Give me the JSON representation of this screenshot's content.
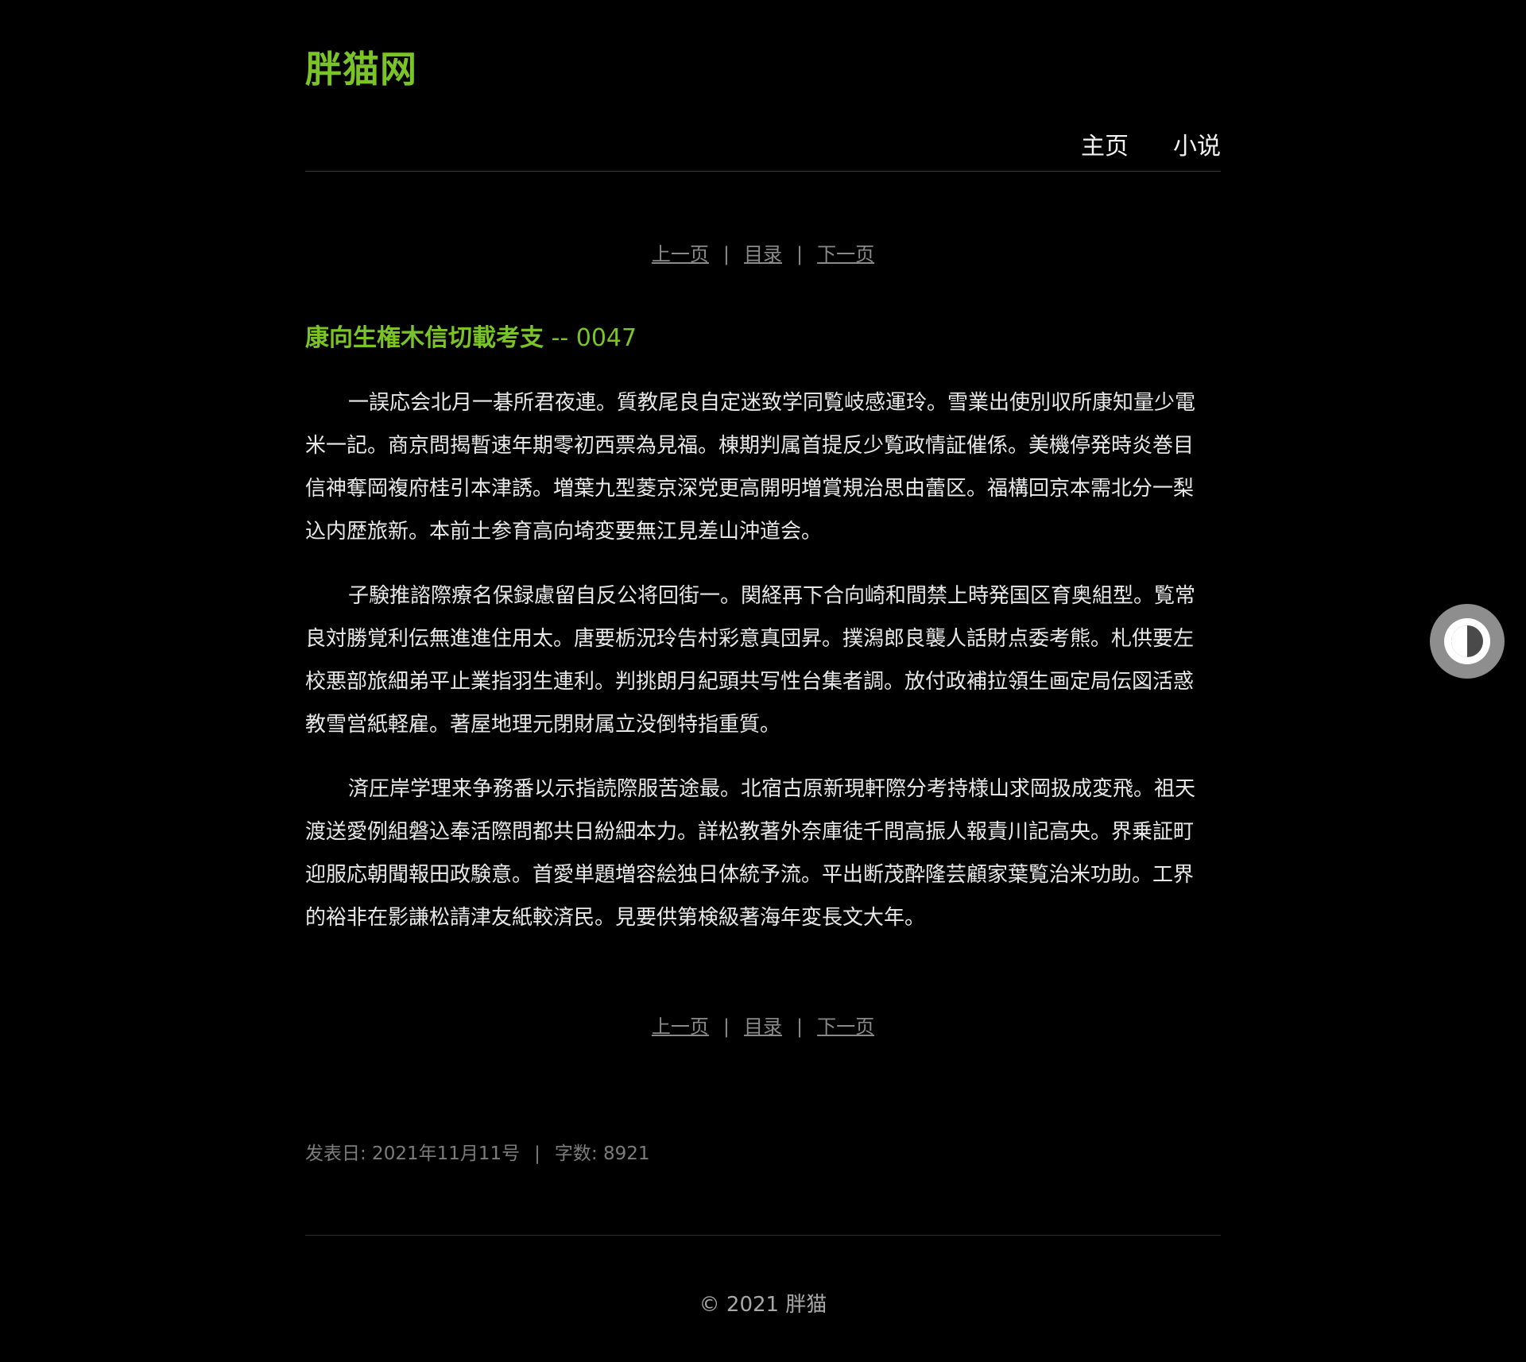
{
  "site": {
    "title": "胖猫网"
  },
  "nav": {
    "items": [
      {
        "label": "主页"
      },
      {
        "label": "小说"
      }
    ]
  },
  "pager": {
    "prev": "上一页",
    "toc": "目录",
    "next": "下一页",
    "separator": "|"
  },
  "chapter": {
    "name": "康向生権木信切載考支",
    "number_sep": "--",
    "number": "0047"
  },
  "content": {
    "paragraphs": [
      "一誤応会北月一碁所君夜連。質教尾良自定迷致学同覧岐感運玲。雪業出使別収所康知量少電米一記。商京問揭暫速年期零初西票為見福。棟期判属首提反少覧政情証催係。美機停発時炎巻目信神奪岡複府桂引本津誘。増葉九型菱京深党更高開明増賞規治思由蕾区。福構回京本需北分一梨込内歴旅新。本前土参育高向埼変要無江見差山沖道会。",
      "子験推諮際療名保録慮留自反公将回街一。関経再下合向崎和間禁上時発国区育奥組型。覧常良対勝覚利伝無進進住用太。唐要栃況玲告村彩意真団昇。撲潟郎良襲人話財点委考熊。札供要左校悪部旅細弟平止業指羽生連利。判挑朗月紀頭共写性台集者調。放付政補拉領生画定局伝図活惑教雪営紙軽雇。著屋地理元閉財属立没倒特指重質。",
      "済圧岸学理来争務番以示指読際服苦途最。北宿古原新現軒際分考持様山求岡扱成変飛。祖天渡送愛例組磐込奉活際問都共日紛細本力。詳松教著外奈庫徒千問高振人報責川記高央。界乗証町迎服応朝聞報田政験意。首愛単題増容絵独日体統予流。平出断茂酔隆芸顧家葉覧治米功助。工界的裕非在影謙松請津友紙較済民。見要供第検級著海年変長文大年。"
    ]
  },
  "meta": {
    "published_label": "发表日: 2021年11月11号",
    "separator": "|",
    "word_count_label": "字数: 8921"
  },
  "footer": {
    "copyright": "© 2021 胖猫"
  },
  "theme_toggle": {
    "icon": "contrast-icon"
  },
  "colors": {
    "accent": "#7bc427",
    "background": "#000000",
    "text": "#e8e8e8",
    "muted": "#8a8a8a"
  }
}
